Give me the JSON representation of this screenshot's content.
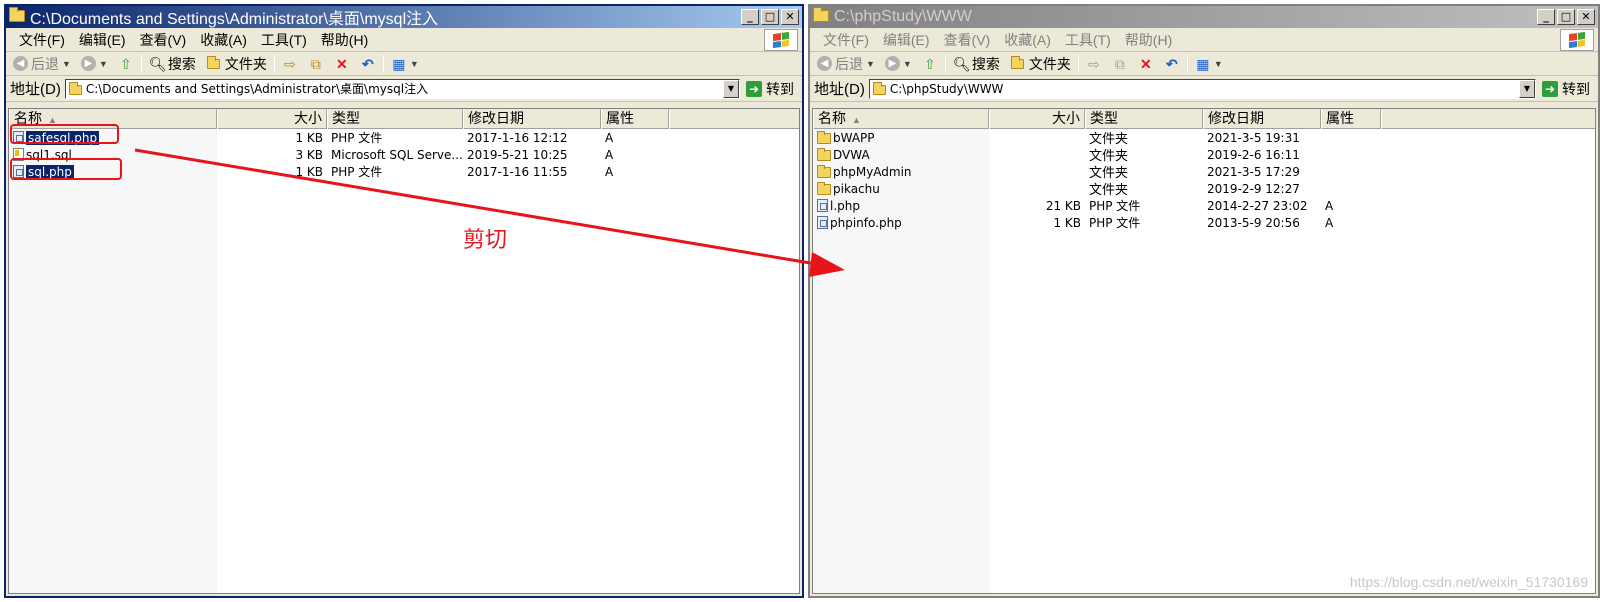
{
  "left": {
    "title": "C:\\Documents and Settings\\Administrator\\桌面\\mysql注入",
    "menu": [
      "文件(F)",
      "编辑(E)",
      "查看(V)",
      "收藏(A)",
      "工具(T)",
      "帮助(H)"
    ],
    "toolbar": {
      "back": "后退",
      "search": "搜索",
      "folders": "文件夹"
    },
    "address_label": "地址(D)",
    "address": "C:\\Documents and Settings\\Administrator\\桌面\\mysql注入",
    "go": "转到",
    "columns": {
      "name": "名称",
      "size": "大小",
      "type": "类型",
      "modified": "修改日期",
      "attr": "属性"
    },
    "files": [
      {
        "name": "safesql.php",
        "size": "1 KB",
        "type": "PHP 文件",
        "modified": "2017-1-16 12:12",
        "attr": "A",
        "icon": "php-file-icon",
        "selected": true
      },
      {
        "name": "sql1.sql",
        "size": "3 KB",
        "type": "Microsoft SQL Serve...",
        "modified": "2019-5-21 10:25",
        "attr": "A",
        "icon": "sql-file-icon",
        "selected": false
      },
      {
        "name": "sql.php",
        "size": "1 KB",
        "type": "PHP 文件",
        "modified": "2017-1-16 11:55",
        "attr": "A",
        "icon": "php-file-icon",
        "selected": true
      }
    ]
  },
  "right": {
    "title": "C:\\phpStudy\\WWW",
    "menu": [
      "文件(F)",
      "编辑(E)",
      "查看(V)",
      "收藏(A)",
      "工具(T)",
      "帮助(H)"
    ],
    "toolbar": {
      "back": "后退",
      "search": "搜索",
      "folders": "文件夹"
    },
    "address_label": "地址(D)",
    "address": "C:\\phpStudy\\WWW",
    "go": "转到",
    "columns": {
      "name": "名称",
      "size": "大小",
      "type": "类型",
      "modified": "修改日期",
      "attr": "属性"
    },
    "files": [
      {
        "name": "bWAPP",
        "size": "",
        "type": "文件夹",
        "modified": "2021-3-5 19:31",
        "attr": "",
        "icon": "folder-icon"
      },
      {
        "name": "DVWA",
        "size": "",
        "type": "文件夹",
        "modified": "2019-2-6 16:11",
        "attr": "",
        "icon": "folder-icon"
      },
      {
        "name": "phpMyAdmin",
        "size": "",
        "type": "文件夹",
        "modified": "2021-3-5 17:29",
        "attr": "",
        "icon": "folder-icon"
      },
      {
        "name": "pikachu",
        "size": "",
        "type": "文件夹",
        "modified": "2019-2-9 12:27",
        "attr": "",
        "icon": "folder-icon"
      },
      {
        "name": "l.php",
        "size": "21 KB",
        "type": "PHP 文件",
        "modified": "2014-2-27 23:02",
        "attr": "A",
        "icon": "php-file-icon"
      },
      {
        "name": "phpinfo.php",
        "size": "1 KB",
        "type": "PHP 文件",
        "modified": "2013-5-9 20:56",
        "attr": "A",
        "icon": "php-file-icon"
      }
    ]
  },
  "annotation": {
    "text": "剪切",
    "color": "#e8141c"
  },
  "watermark": "https://blog.csdn.net/weixin_51730169",
  "colors": {
    "active_title": "#0a246a",
    "inactive_title": "#808080",
    "selection": "#0a246a"
  }
}
